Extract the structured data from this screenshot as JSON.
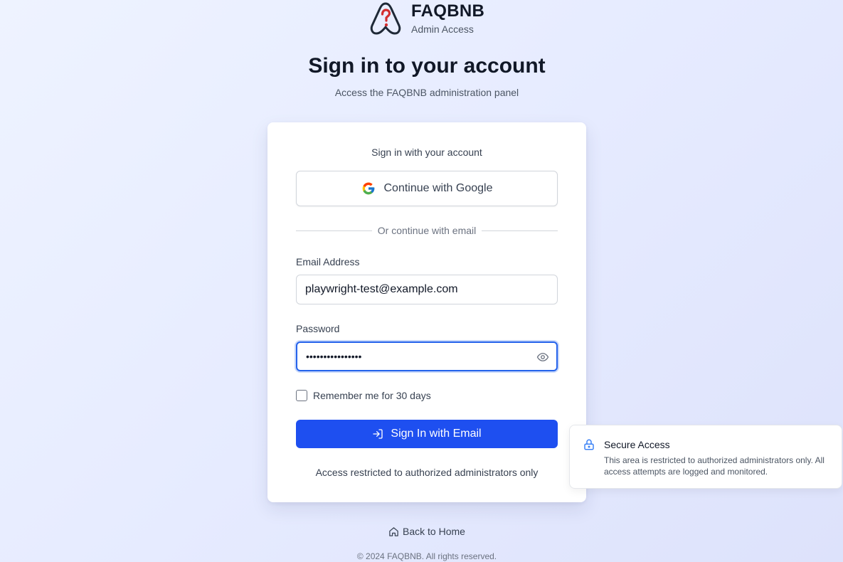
{
  "brand": {
    "name": "FAQBNB",
    "subtitle": "Admin Access",
    "accent_color": "#d32f2f"
  },
  "page": {
    "title": "Sign in to your account",
    "subtitle": "Access the FAQBNB administration panel"
  },
  "card": {
    "heading": "Sign in with your account",
    "google_button_label": "Continue with Google",
    "divider_text": "Or continue with email",
    "email": {
      "label": "Email Address",
      "value": "playwright-test@example.com"
    },
    "password": {
      "label": "Password",
      "masked_value": "••••••••••••••••"
    },
    "remember_label": "Remember me for 30 days",
    "remember_checked": false,
    "submit_label": "Sign In with Email",
    "submit_color": "#1e4ff0",
    "restricted_note": "Access restricted to authorized administrators only"
  },
  "footer": {
    "back_home_label": "Back to Home",
    "copyright": "© 2024 FAQBNB. All rights reserved."
  },
  "toast": {
    "title": "Secure Access",
    "body": "This area is restricted to authorized administrators only. All access attempts are logged and monitored.",
    "icon": "lock-icon"
  }
}
